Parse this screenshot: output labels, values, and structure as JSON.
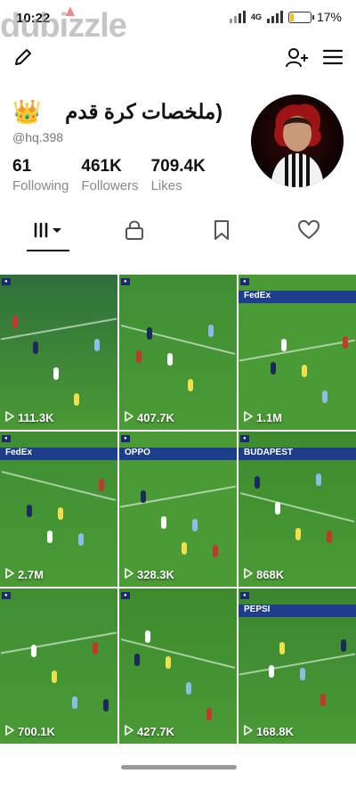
{
  "status_bar": {
    "time": "10:22",
    "network": "4G",
    "battery": "17%",
    "battery_level": 0.17
  },
  "watermark": {
    "text": "dubizzle"
  },
  "profile": {
    "name": "(ملخصات كرة قدم",
    "crown": "👑",
    "handle": "@hq.398",
    "stats": [
      {
        "value": "61",
        "label": "Following"
      },
      {
        "value": "461K",
        "label": "Followers"
      },
      {
        "value": "709.4K",
        "label": "Likes"
      }
    ]
  },
  "icons": {
    "edit": "pencil-icon",
    "add_friend": "add-user-icon",
    "menu": "hamburger-menu-icon"
  },
  "tabs": [
    {
      "icon": "videos-grid-icon",
      "active": true
    },
    {
      "icon": "lock-icon",
      "active": false
    },
    {
      "icon": "bookmark-icon",
      "active": false
    },
    {
      "icon": "heart-icon",
      "active": false
    }
  ],
  "videos": [
    {
      "views": "111.3K"
    },
    {
      "views": "407.7K"
    },
    {
      "views": "1.1M"
    },
    {
      "views": "2.7M"
    },
    {
      "views": "328.3K"
    },
    {
      "views": "868K"
    },
    {
      "views": "700.1K"
    },
    {
      "views": "427.7K"
    },
    {
      "views": "168.8K"
    }
  ],
  "tile_boards": [
    "FedEx",
    "FedEx",
    "OPPO",
    "BUDAPEST",
    "PEPSI"
  ],
  "colors": {
    "pitch": "#3d8b2e",
    "pitch_light": "#4a9a36",
    "accent_gold": "#f3c21b",
    "avatar_red": "#c41a1a"
  }
}
